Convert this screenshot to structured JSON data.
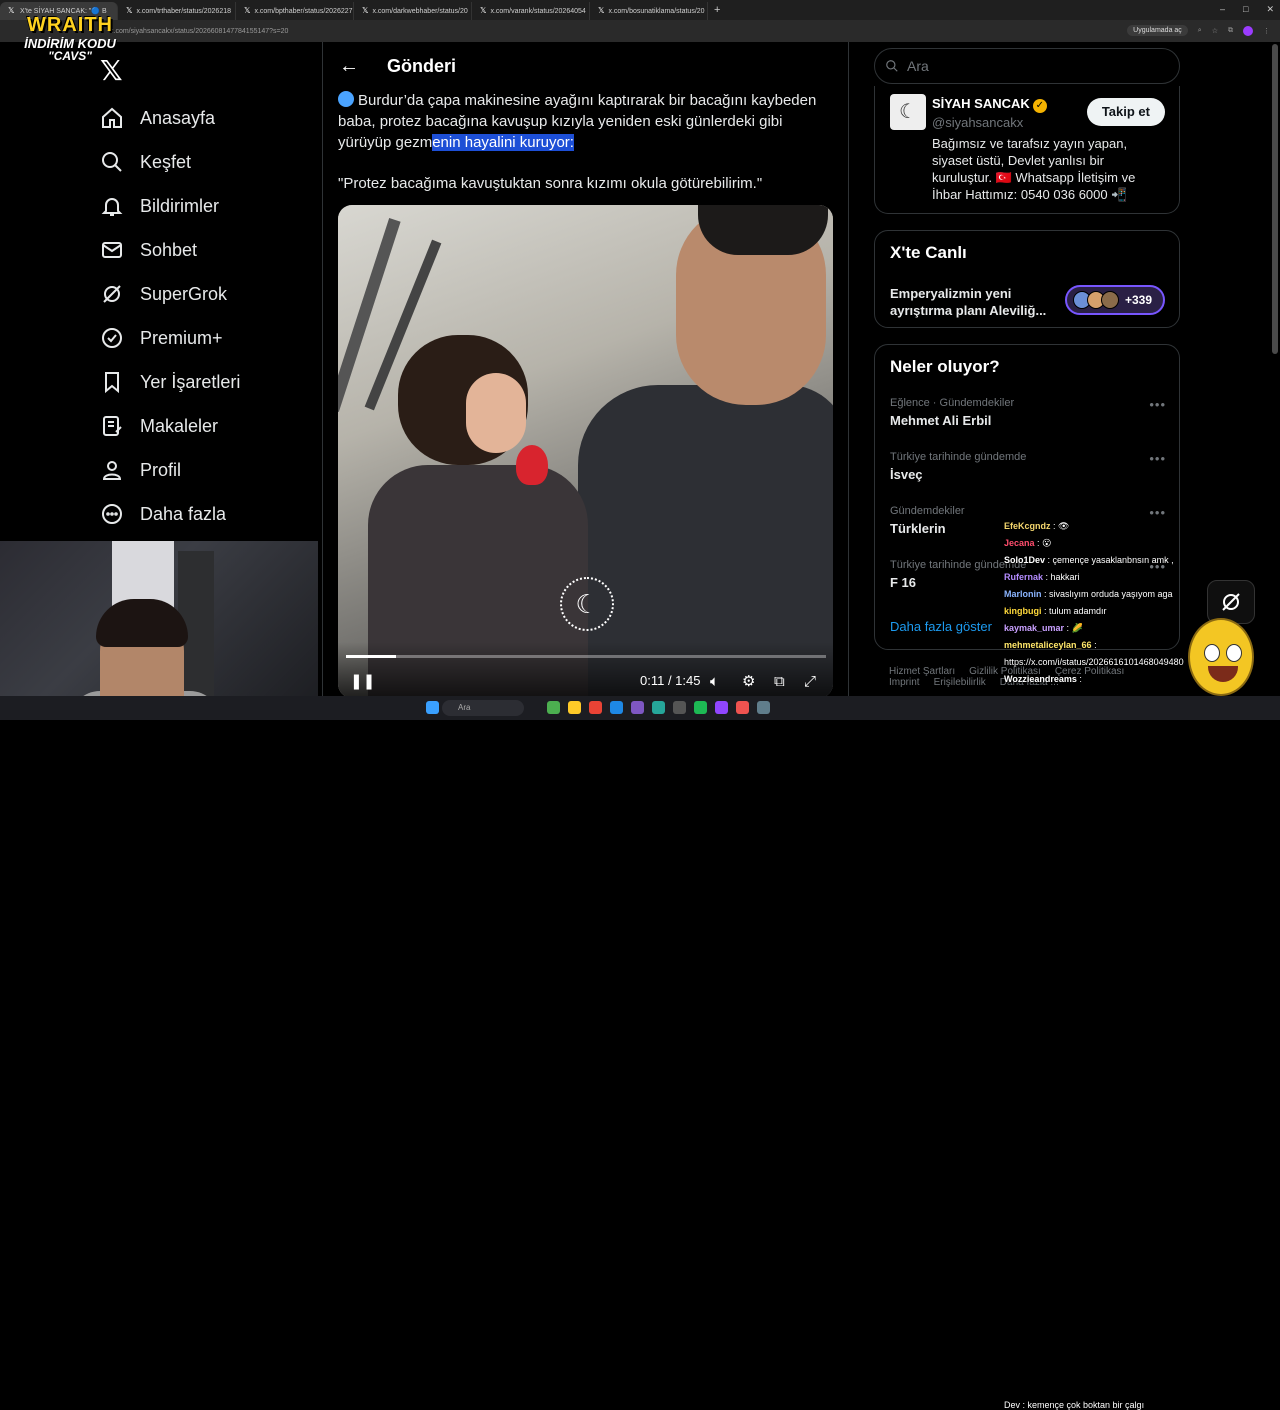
{
  "browser": {
    "tabs": [
      {
        "label": "X'te SİYAH SANCAK: \"🔵 B",
        "active": true
      },
      {
        "label": "x.com/trthaber/status/2026218",
        "active": false
      },
      {
        "label": "x.com/bpthaber/status/2026227",
        "active": false
      },
      {
        "label": "x.com/darkwebhaber/status/20",
        "active": false
      },
      {
        "label": "x.com/varank/status/20264054",
        "active": false
      },
      {
        "label": "x.com/bosunatiklama/status/20",
        "active": false
      }
    ],
    "address": "x.com/siyahsancakx/status/2026608147784155147?s=20",
    "open_in_app": "Uygulamada aç"
  },
  "overlay": {
    "brand": "WRAITH",
    "line1": "İNDİRİM KODU",
    "line2": "\"CAVS\""
  },
  "nav": {
    "logo": "𝕏",
    "items": [
      {
        "label": "Anasayfa",
        "icon": "home-icon"
      },
      {
        "label": "Keşfet",
        "icon": "search-icon"
      },
      {
        "label": "Bildirimler",
        "icon": "bell-icon"
      },
      {
        "label": "Sohbet",
        "icon": "mail-icon"
      },
      {
        "label": "SuperGrok",
        "icon": "grok-icon"
      },
      {
        "label": "Premium+",
        "icon": "verified-icon"
      },
      {
        "label": "Yer İşaretleri",
        "icon": "bookmark-icon"
      },
      {
        "label": "Makaleler",
        "icon": "article-icon"
      },
      {
        "label": "Profil",
        "icon": "person-icon"
      },
      {
        "label": "Daha fazla",
        "icon": "more-circle-icon"
      }
    ]
  },
  "post": {
    "header_title": "Gönderi",
    "text_before_highlight": "Burdur’da çapa makinesine ayağını kaptırarak bir bacağını kaybeden baba, protez bacağına kavuşup kızıyla yeniden eski günlerdeki gibi yürüyüp gezm",
    "text_highlight": "enin hayalini kuruyor:",
    "quote": "\"Protez bacağıma kavuştuktan sonra kızımı okula götürebilirim.\"",
    "video": {
      "time": "0:11 / 1:45",
      "progress": 0.105
    }
  },
  "sidebar": {
    "search_placeholder": "Ara",
    "profile": {
      "name": "SİYAH SANCAK",
      "handle": "@siyahsancakx",
      "follow_label": "Takip et",
      "bio": "Bağımsız ve tarafsız yayın yapan, siyaset üstü, Devlet yanlısı bir kuruluştur. 🇹🇷 Whatsapp İletişim ve İhbar Hattımız: 0540 036 6000 📲"
    },
    "live": {
      "title": "X'te Canlı",
      "topic": "Emperyalizmin yeni ayrıştırma planı Aleviliğ...",
      "count": "+339"
    },
    "trends": {
      "title": "Neler oluyor?",
      "items": [
        {
          "category": "Eğlence · Gündemdekiler",
          "name": "Mehmet Ali Erbil"
        },
        {
          "category": "Türkiye tarihinde gündemde",
          "name": "İsveç"
        },
        {
          "category": "Gündemdekiler",
          "name": "Türklerin"
        },
        {
          "category": "Türkiye tarihinde gündemde",
          "name": "F 16"
        }
      ],
      "show_more": "Daha fazla göster"
    },
    "footer": [
      "Hizmet Şartları",
      "Gizlilik Politikası",
      "Çerez Politikası",
      "Imprint",
      "Erişilebilirlik",
      "Daha fazla ..."
    ]
  },
  "chat": [
    {
      "user": "EfeKcgndz",
      "msg": ": 👁",
      "color": "#f5d76e"
    },
    {
      "user": "Jecana",
      "msg": ": 😮",
      "color": "#ff4d6d"
    },
    {
      "user": "Solo1Dev",
      "msg": ": çemençe yasaklanbnsın amk ,",
      "color": "#ffffff"
    },
    {
      "user": "Rufernak",
      "msg": ": hakkari",
      "color": "#b48cff"
    },
    {
      "user": "Marlonin",
      "msg": ": sivaslıyım orduda yaşıyom aga",
      "color": "#8ab4ff"
    },
    {
      "user": "kingbugi",
      "msg": ": tulum adamdır",
      "color": "#ffd93b"
    },
    {
      "user": "kaymak_umar",
      "msg": ": 🌽",
      "color": "#c9a0ff"
    },
    {
      "user": "mehmetaliceylan_66",
      "msg": ":",
      "color": "#ffe76a"
    },
    {
      "user": "",
      "msg": "https://x.com/i/status/2026616101468049480",
      "color": "#ffffff"
    },
    {
      "user": "Wozzieandreams",
      "msg": ":",
      "color": "#ffffff"
    }
  ],
  "taskbar": {
    "search": "Ara",
    "note": "Dev : kemençe çok boktan bir çalgı"
  }
}
